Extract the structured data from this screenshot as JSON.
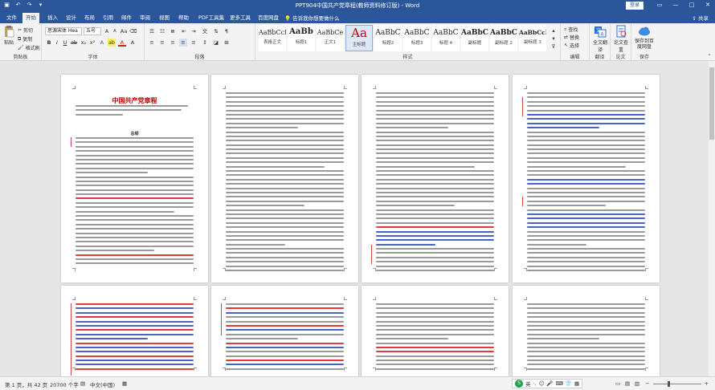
{
  "window": {
    "title": "PPT904中国共产党章程(教师资料修订版) - Word",
    "login": "登录",
    "controls": [
      "—",
      "□",
      "✕"
    ]
  },
  "tabs": [
    "文件",
    "开始",
    "插入",
    "设计",
    "布局",
    "引用",
    "邮件",
    "审阅",
    "视图",
    "帮助",
    "PDF工具集",
    "更多工具",
    "百度网盘"
  ],
  "active_tab": "开始",
  "tell_me": "告诉我你想要做什么",
  "share": "共享",
  "ribbon": {
    "clipboard": {
      "paste": "粘贴",
      "cut": "剪切",
      "copy": "复制",
      "format_painter": "格式刷",
      "label": "剪贴板"
    },
    "font": {
      "font_name": "思源宋体 Hea",
      "font_size": "五号",
      "label": "字体"
    },
    "paragraph": {
      "label": "段落"
    },
    "styles": {
      "label": "样式",
      "items": [
        {
          "sample": "AaBbCcI",
          "name": "表格正文"
        },
        {
          "sample": "AaBb",
          "name": "标题1"
        },
        {
          "sample": "AaBbCe",
          "name": "正文1"
        },
        {
          "sample": "Aa",
          "name": "主标题"
        },
        {
          "sample": "AaBbC",
          "name": "标题2"
        },
        {
          "sample": "AaBbC",
          "name": "标题3"
        },
        {
          "sample": "AaBbC",
          "name": "标题 4"
        },
        {
          "sample": "AaBbC",
          "name": "副标题"
        },
        {
          "sample": "AaBbC",
          "name": "副标题 2"
        },
        {
          "sample": "AaBbCcD",
          "name": "副标题 3"
        }
      ]
    },
    "editing": {
      "find": "查找",
      "replace": "替换",
      "select": "选择",
      "label": "编辑"
    },
    "translate": {
      "button": "全文翻译",
      "label": "翻译"
    },
    "paper": {
      "button": "论文查重",
      "label": "论文"
    },
    "save": {
      "button": "保存到百度网盘",
      "label": "保存"
    }
  },
  "document": {
    "heading": "中国共产党章程",
    "chapter": "总纲"
  },
  "status": {
    "page": "第 1 页，共 42 页",
    "words": "20700 个字",
    "lang": "中文(中国)",
    "ime": "英",
    "zoom": "+"
  },
  "colors": {
    "accent": "#2b579a",
    "heading_red": "#c00000"
  }
}
